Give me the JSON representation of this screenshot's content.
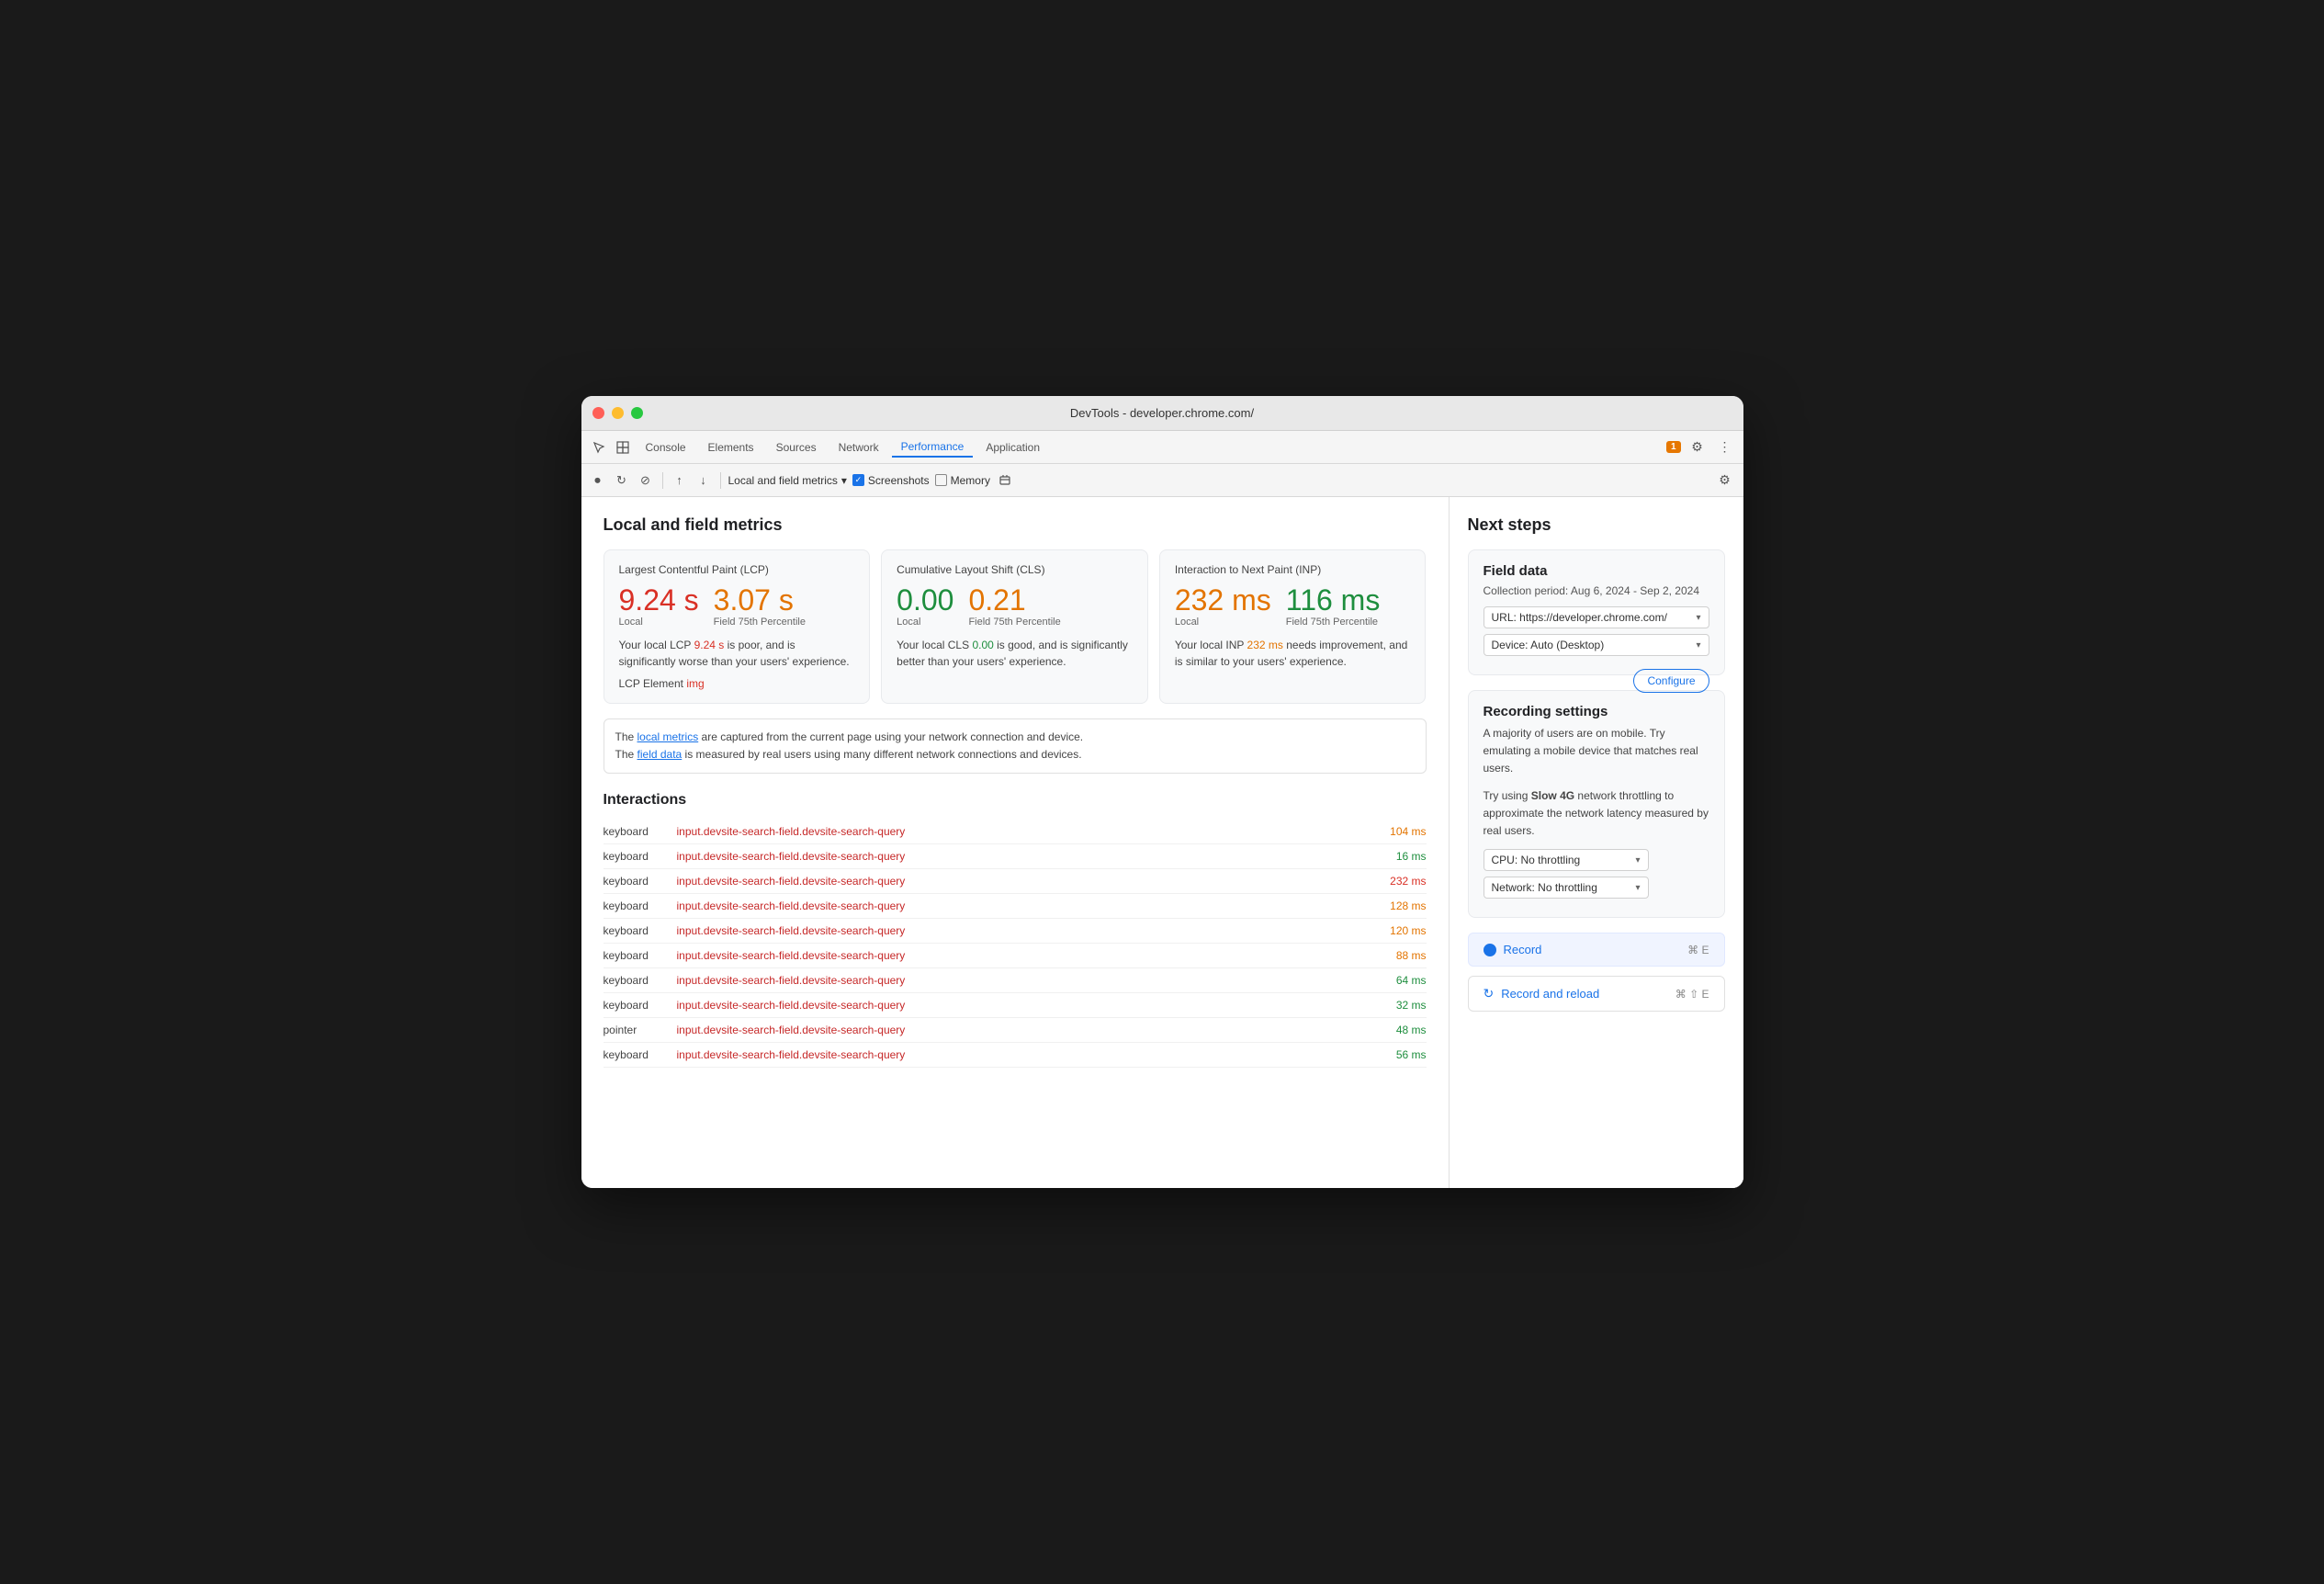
{
  "window": {
    "title": "DevTools - developer.chrome.com/"
  },
  "tabs_bar": {
    "tabs": [
      {
        "label": "Console",
        "active": false
      },
      {
        "label": "Elements",
        "active": false
      },
      {
        "label": "Sources",
        "active": false
      },
      {
        "label": "Network",
        "active": false
      },
      {
        "label": "Performance",
        "active": true
      },
      {
        "label": "Application",
        "active": false
      }
    ],
    "badge": "1",
    "settings_icon": "⚙",
    "more_icon": "⋮"
  },
  "toolbar": {
    "record_icon": "⏺",
    "reload_icon": "↻",
    "clear_icon": "⊘",
    "upload_icon": "↑",
    "download_icon": "↓",
    "mode_label": "Local and field metrics",
    "screenshots_label": "Screenshots",
    "memory_label": "Memory",
    "settings_icon": "⚙"
  },
  "main": {
    "section_title": "Local and field metrics",
    "metrics": [
      {
        "title": "Largest Contentful Paint (LCP)",
        "local_value": "9.24 s",
        "local_color": "red",
        "field_value": "3.07 s",
        "field_color": "orange",
        "local_label": "Local",
        "field_label": "Field 75th Percentile",
        "description": "Your local LCP 9.24 s is poor, and is significantly worse than your users' experience.",
        "desc_highlight": "9.24 s",
        "element_label": "LCP Element",
        "element_value": "img",
        "element_color": "red"
      },
      {
        "title": "Cumulative Layout Shift (CLS)",
        "local_value": "0.00",
        "local_color": "green",
        "field_value": "0.21",
        "field_color": "orange",
        "local_label": "Local",
        "field_label": "Field 75th Percentile",
        "description": "Your local CLS 0.00 is good, and is significantly better than your users' experience.",
        "desc_highlight": "0.00"
      },
      {
        "title": "Interaction to Next Paint (INP)",
        "local_value": "232 ms",
        "local_color": "orange",
        "field_value": "116 ms",
        "field_color": "green",
        "local_label": "Local",
        "field_label": "Field 75th Percentile",
        "description": "Your local INP 232 ms needs improvement, and is similar to your users' experience.",
        "desc_highlight": "232 ms"
      }
    ],
    "info_text_1": "The local metrics are captured from the current page using your network connection and device.",
    "info_text_2": "The field data is measured by real users using many different network connections and devices.",
    "local_metrics_link": "local metrics",
    "field_data_link": "field data",
    "interactions_title": "Interactions",
    "interactions": [
      {
        "type": "keyboard",
        "target": "input.devsite-search-field.devsite-search-query",
        "ms": "104 ms",
        "ms_color": "orange"
      },
      {
        "type": "keyboard",
        "target": "input.devsite-search-field.devsite-search-query",
        "ms": "16 ms",
        "ms_color": "green"
      },
      {
        "type": "keyboard",
        "target": "input.devsite-search-field.devsite-search-query",
        "ms": "232 ms",
        "ms_color": "red"
      },
      {
        "type": "keyboard",
        "target": "input.devsite-search-field.devsite-search-query",
        "ms": "128 ms",
        "ms_color": "orange"
      },
      {
        "type": "keyboard",
        "target": "input.devsite-search-field.devsite-search-query",
        "ms": "120 ms",
        "ms_color": "orange"
      },
      {
        "type": "keyboard",
        "target": "input.devsite-search-field.devsite-search-query",
        "ms": "88 ms",
        "ms_color": "orange"
      },
      {
        "type": "keyboard",
        "target": "input.devsite-search-field.devsite-search-query",
        "ms": "64 ms",
        "ms_color": "green"
      },
      {
        "type": "keyboard",
        "target": "input.devsite-search-field.devsite-search-query",
        "ms": "32 ms",
        "ms_color": "green"
      },
      {
        "type": "pointer",
        "target": "input.devsite-search-field.devsite-search-query",
        "ms": "48 ms",
        "ms_color": "green"
      },
      {
        "type": "keyboard",
        "target": "input.devsite-search-field.devsite-search-query",
        "ms": "56 ms",
        "ms_color": "green"
      }
    ]
  },
  "right_panel": {
    "next_steps_title": "Next steps",
    "field_data": {
      "title": "Field data",
      "collection_period": "Collection period: Aug 6, 2024 - Sep 2, 2024",
      "url_label": "URL: https://developer.chrome.com/",
      "device_label": "Device: Auto (Desktop)",
      "configure_label": "Configure"
    },
    "recording_settings": {
      "title": "Recording settings",
      "description1": "A majority of users are on mobile. Try emulating a mobile device that matches real users.",
      "description2": "Try using",
      "slow_4g": "Slow 4G",
      "description3": "network throttling to approximate the network latency measured by real users.",
      "cpu_label": "CPU: No throttling",
      "network_label": "Network: No throttling"
    },
    "record": {
      "label": "Record",
      "shortcut": "⌘ E"
    },
    "record_reload": {
      "label": "Record and reload",
      "shortcut": "⌘ ⇧ E"
    }
  }
}
